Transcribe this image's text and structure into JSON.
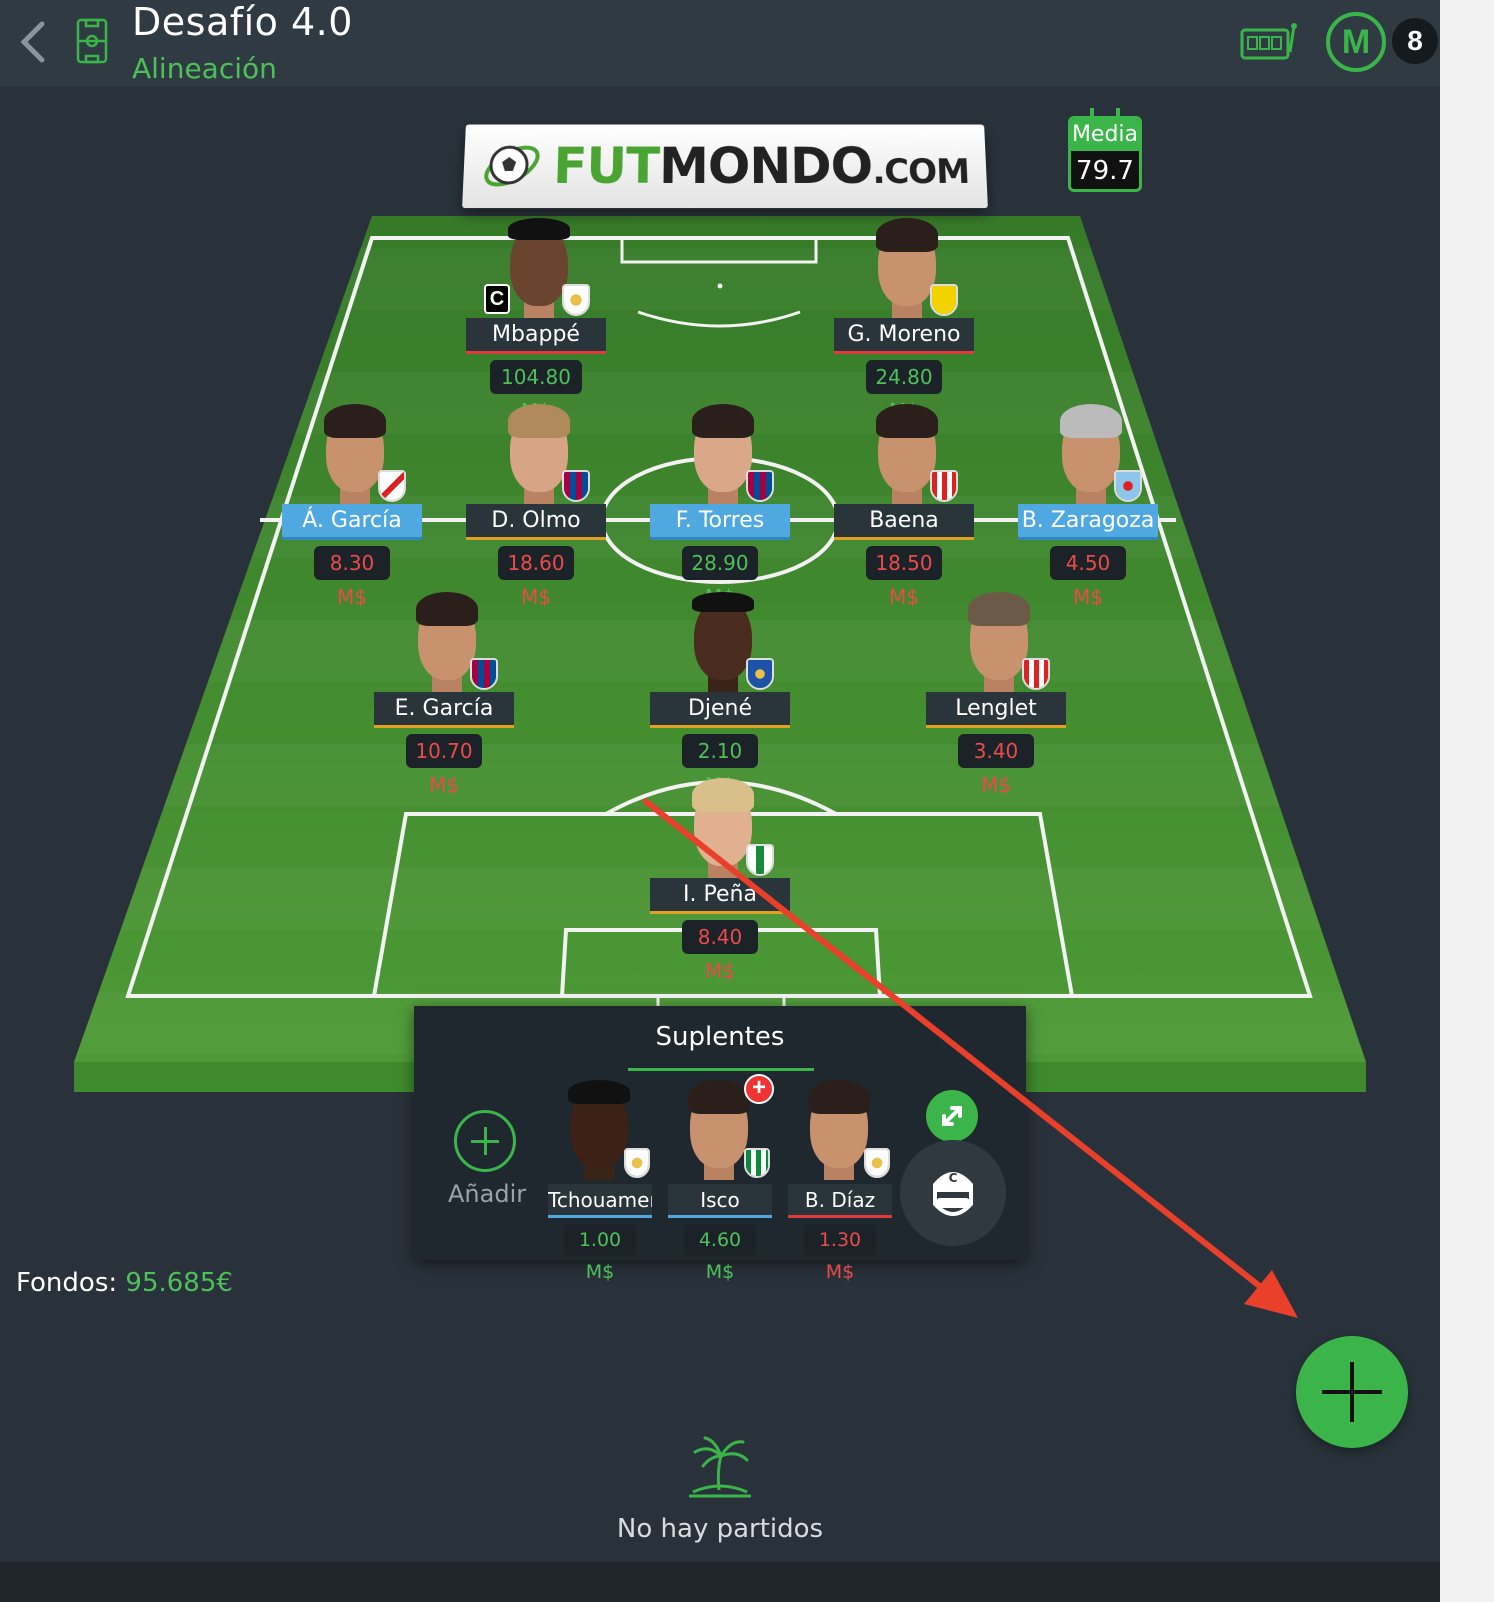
{
  "header": {
    "title": "Desafío 4.0",
    "subtitle": "Alineación",
    "badge_count": "8",
    "logo_letter": "M"
  },
  "banner": {
    "brand_green": "FUT",
    "brand_dark": "MONDO",
    "brand_suffix": ".COM"
  },
  "media": {
    "label": "Media",
    "value": "79.7"
  },
  "lineup": {
    "forwards": [
      {
        "name": "Mbappé",
        "price": "104.80 M$",
        "price_color": "green",
        "captain": "C",
        "crest": "real-madrid"
      },
      {
        "name": "G. Moreno",
        "price": "24.80 M$",
        "price_color": "green",
        "crest": "villarreal"
      }
    ],
    "midfielders": [
      {
        "name": "Á. García",
        "price": "8.30 M$",
        "price_color": "red",
        "crest": "rayo"
      },
      {
        "name": "D. Olmo",
        "price": "18.60 M$",
        "price_color": "red",
        "crest": "barcelona"
      },
      {
        "name": "F. Torres",
        "price": "28.90 M$",
        "price_color": "green",
        "crest": "barcelona"
      },
      {
        "name": "Baena",
        "price": "18.50 M$",
        "price_color": "red",
        "crest": "atletico"
      },
      {
        "name": "B. Zaragoza",
        "price": "4.50 M$",
        "price_color": "red",
        "crest": "celta"
      }
    ],
    "defenders": [
      {
        "name": "E. García",
        "price": "10.70 M$",
        "price_color": "red",
        "crest": "barcelona"
      },
      {
        "name": "Djené",
        "price": "2.10 M$",
        "price_color": "green",
        "crest": "getafe"
      },
      {
        "name": "Lenglet",
        "price": "3.40 M$",
        "price_color": "red",
        "crest": "atletico"
      }
    ],
    "goalkeeper": {
      "name": "I. Peña",
      "price": "8.40 M$",
      "price_color": "red",
      "crest": "elche"
    }
  },
  "substitutes": {
    "title": "Suplentes",
    "add_label": "Añadir",
    "players": [
      {
        "name": "Tchouameni",
        "price": "1.00 M$",
        "price_color": "green",
        "crest": "real-madrid"
      },
      {
        "name": "Isco",
        "price": "4.60 M$",
        "price_color": "green",
        "crest": "betis",
        "injured": "+"
      },
      {
        "name": "B. Díaz",
        "price": "1.30 M$",
        "price_color": "red",
        "crest": "real-madrid"
      }
    ]
  },
  "funds": {
    "label": "Fondos:",
    "value": "95.685€"
  },
  "matches": {
    "empty_text": "No hay partidos"
  },
  "colors": {
    "accent": "#3bb54a",
    "header_bg": "#2f3a42",
    "bg": "#29323a",
    "pitch": "#3f8f2e",
    "arrow": "#e8402a"
  }
}
